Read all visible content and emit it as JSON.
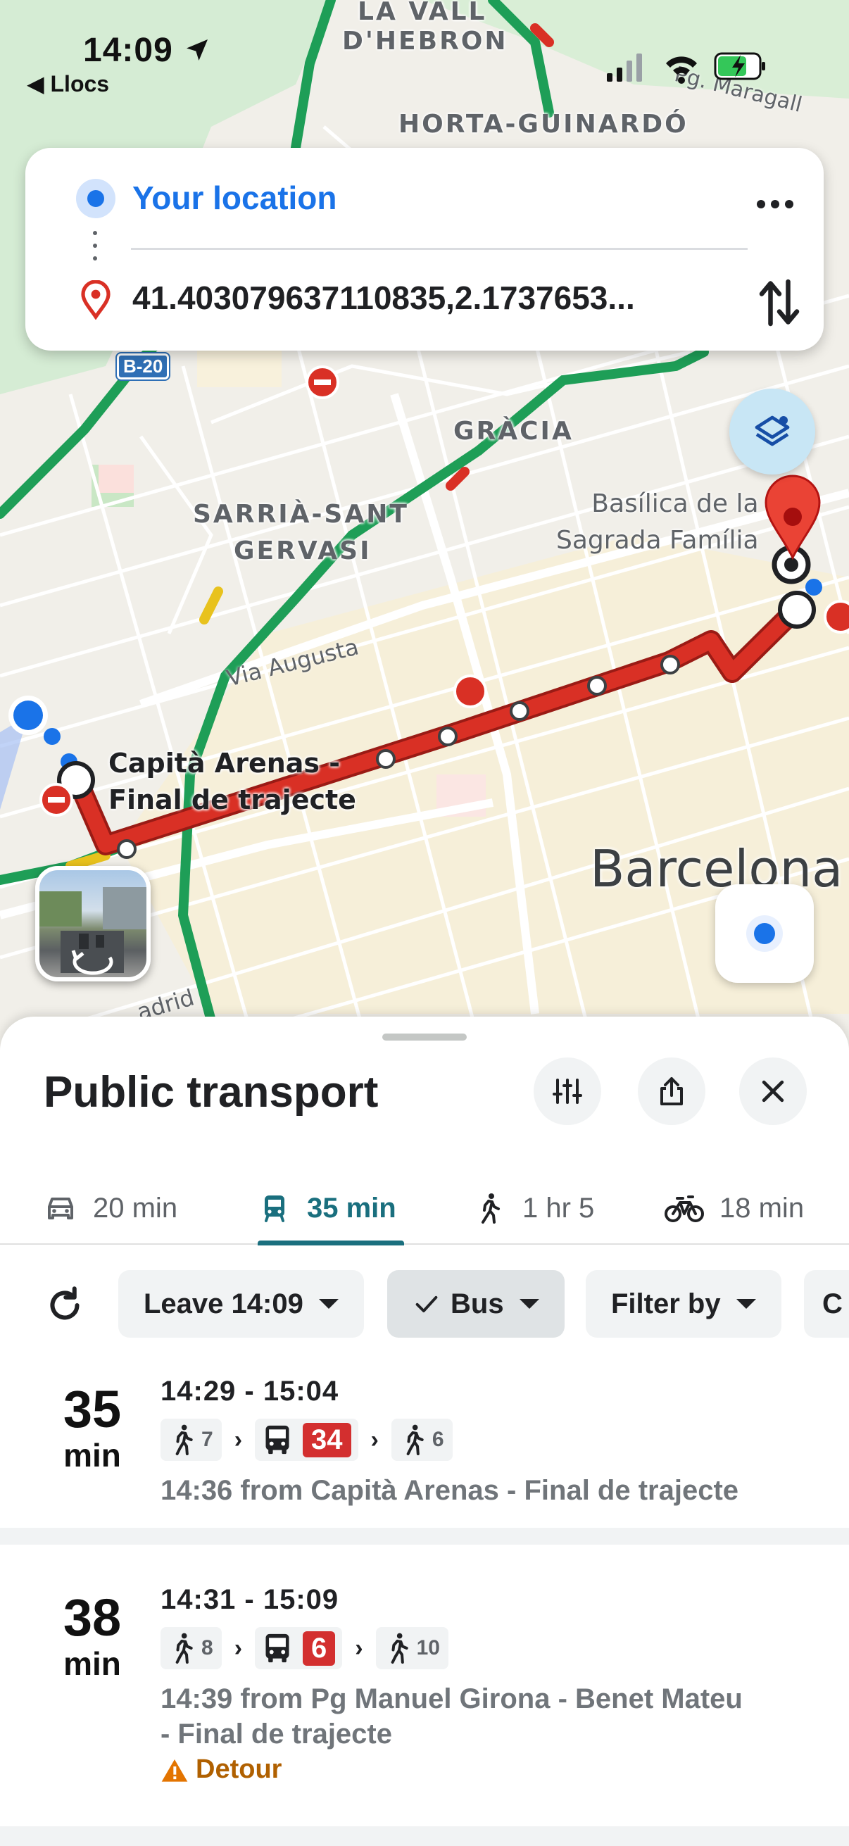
{
  "status_bar": {
    "time": "14:09",
    "back_label": "Llocs"
  },
  "search": {
    "origin": "Your location",
    "destination": "41.403079637110835,2.1737653..."
  },
  "map": {
    "districts": [
      "LA VALL",
      "D'HEBRON",
      "HORTA-GUINARDÓ",
      "GRÀCIA",
      "SARRIÀ-SANT",
      "GERVASI"
    ],
    "streets": [
      "Via Augusta",
      "adrid",
      "Pg. Maragall"
    ],
    "poi": [
      "Basílica de la",
      "Sagrada Família"
    ],
    "city": "Barcelona",
    "stop_label": [
      "Capità Arenas -",
      "Final de trajecte"
    ],
    "road_shield": "B-20"
  },
  "sheet": {
    "title": "Public transport",
    "tabs": [
      {
        "mode": "car",
        "label": "20 min"
      },
      {
        "mode": "transit",
        "label": "35 min"
      },
      {
        "mode": "walk",
        "label": "1 hr 5"
      },
      {
        "mode": "bike",
        "label": "18 min"
      }
    ],
    "filters": {
      "leave": "Leave 14:09",
      "bus": "Bus",
      "filter_by": "Filter by",
      "partial": "C"
    },
    "routes": [
      {
        "duration": "35",
        "unit": "min",
        "times": "14:29 - 15:04",
        "walk_before": "7",
        "line": "34",
        "walk_after": "6",
        "description": "14:36 from Capità Arenas - Final de trajecte"
      },
      {
        "duration": "38",
        "unit": "min",
        "times": "14:31 - 15:09",
        "walk_before": "8",
        "line": "6",
        "walk_after": "10",
        "description_line1": "14:39 from Pg Manuel Girona - Benet Mateu",
        "description_line2": "- Final de trajecte",
        "alert": "Detour"
      }
    ]
  },
  "colors": {
    "accent_blue": "#1a73e8",
    "transit_teal": "#1a6f7e",
    "route_red": "#c5221f",
    "line_badge": "#d32f2f",
    "detour": "#b06000"
  }
}
